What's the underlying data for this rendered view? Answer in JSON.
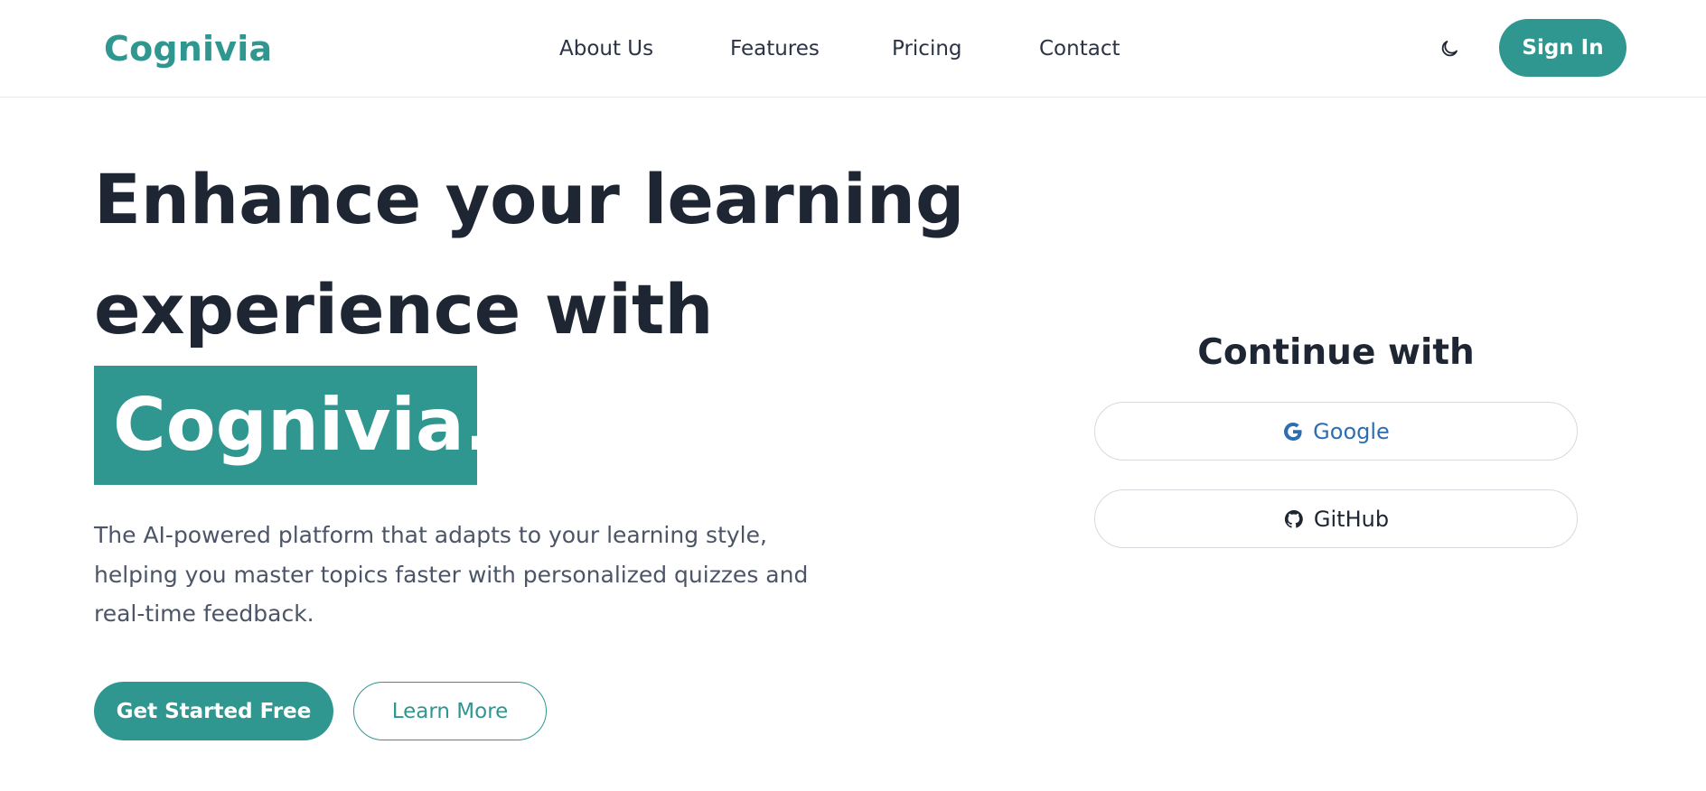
{
  "header": {
    "logo": "Cognivia",
    "nav": [
      {
        "label": "About Us"
      },
      {
        "label": "Features"
      },
      {
        "label": "Pricing"
      },
      {
        "label": "Contact"
      }
    ],
    "theme_toggle_icon": "moon-icon",
    "sign_in_label": "Sign In"
  },
  "hero": {
    "title_line_1": "Enhance your learning",
    "title_line_2": "experience with",
    "brand_highlight": "Cognivia.",
    "description": "The AI-powered platform that adapts to your learning style, helping you master topics faster with personalized quizzes and real-time feedback.",
    "cta_primary": "Get Started Free",
    "cta_secondary": "Learn More"
  },
  "auth_panel": {
    "title": "Continue with",
    "providers": [
      {
        "label": "Google",
        "icon": "google-icon"
      },
      {
        "label": "GitHub",
        "icon": "github-icon"
      }
    ]
  },
  "colors": {
    "accent": "#2f9690",
    "text_dark": "#1e2533",
    "text_muted": "#4c5567",
    "google_blue": "#2f6db3",
    "border": "#d6d9de"
  }
}
